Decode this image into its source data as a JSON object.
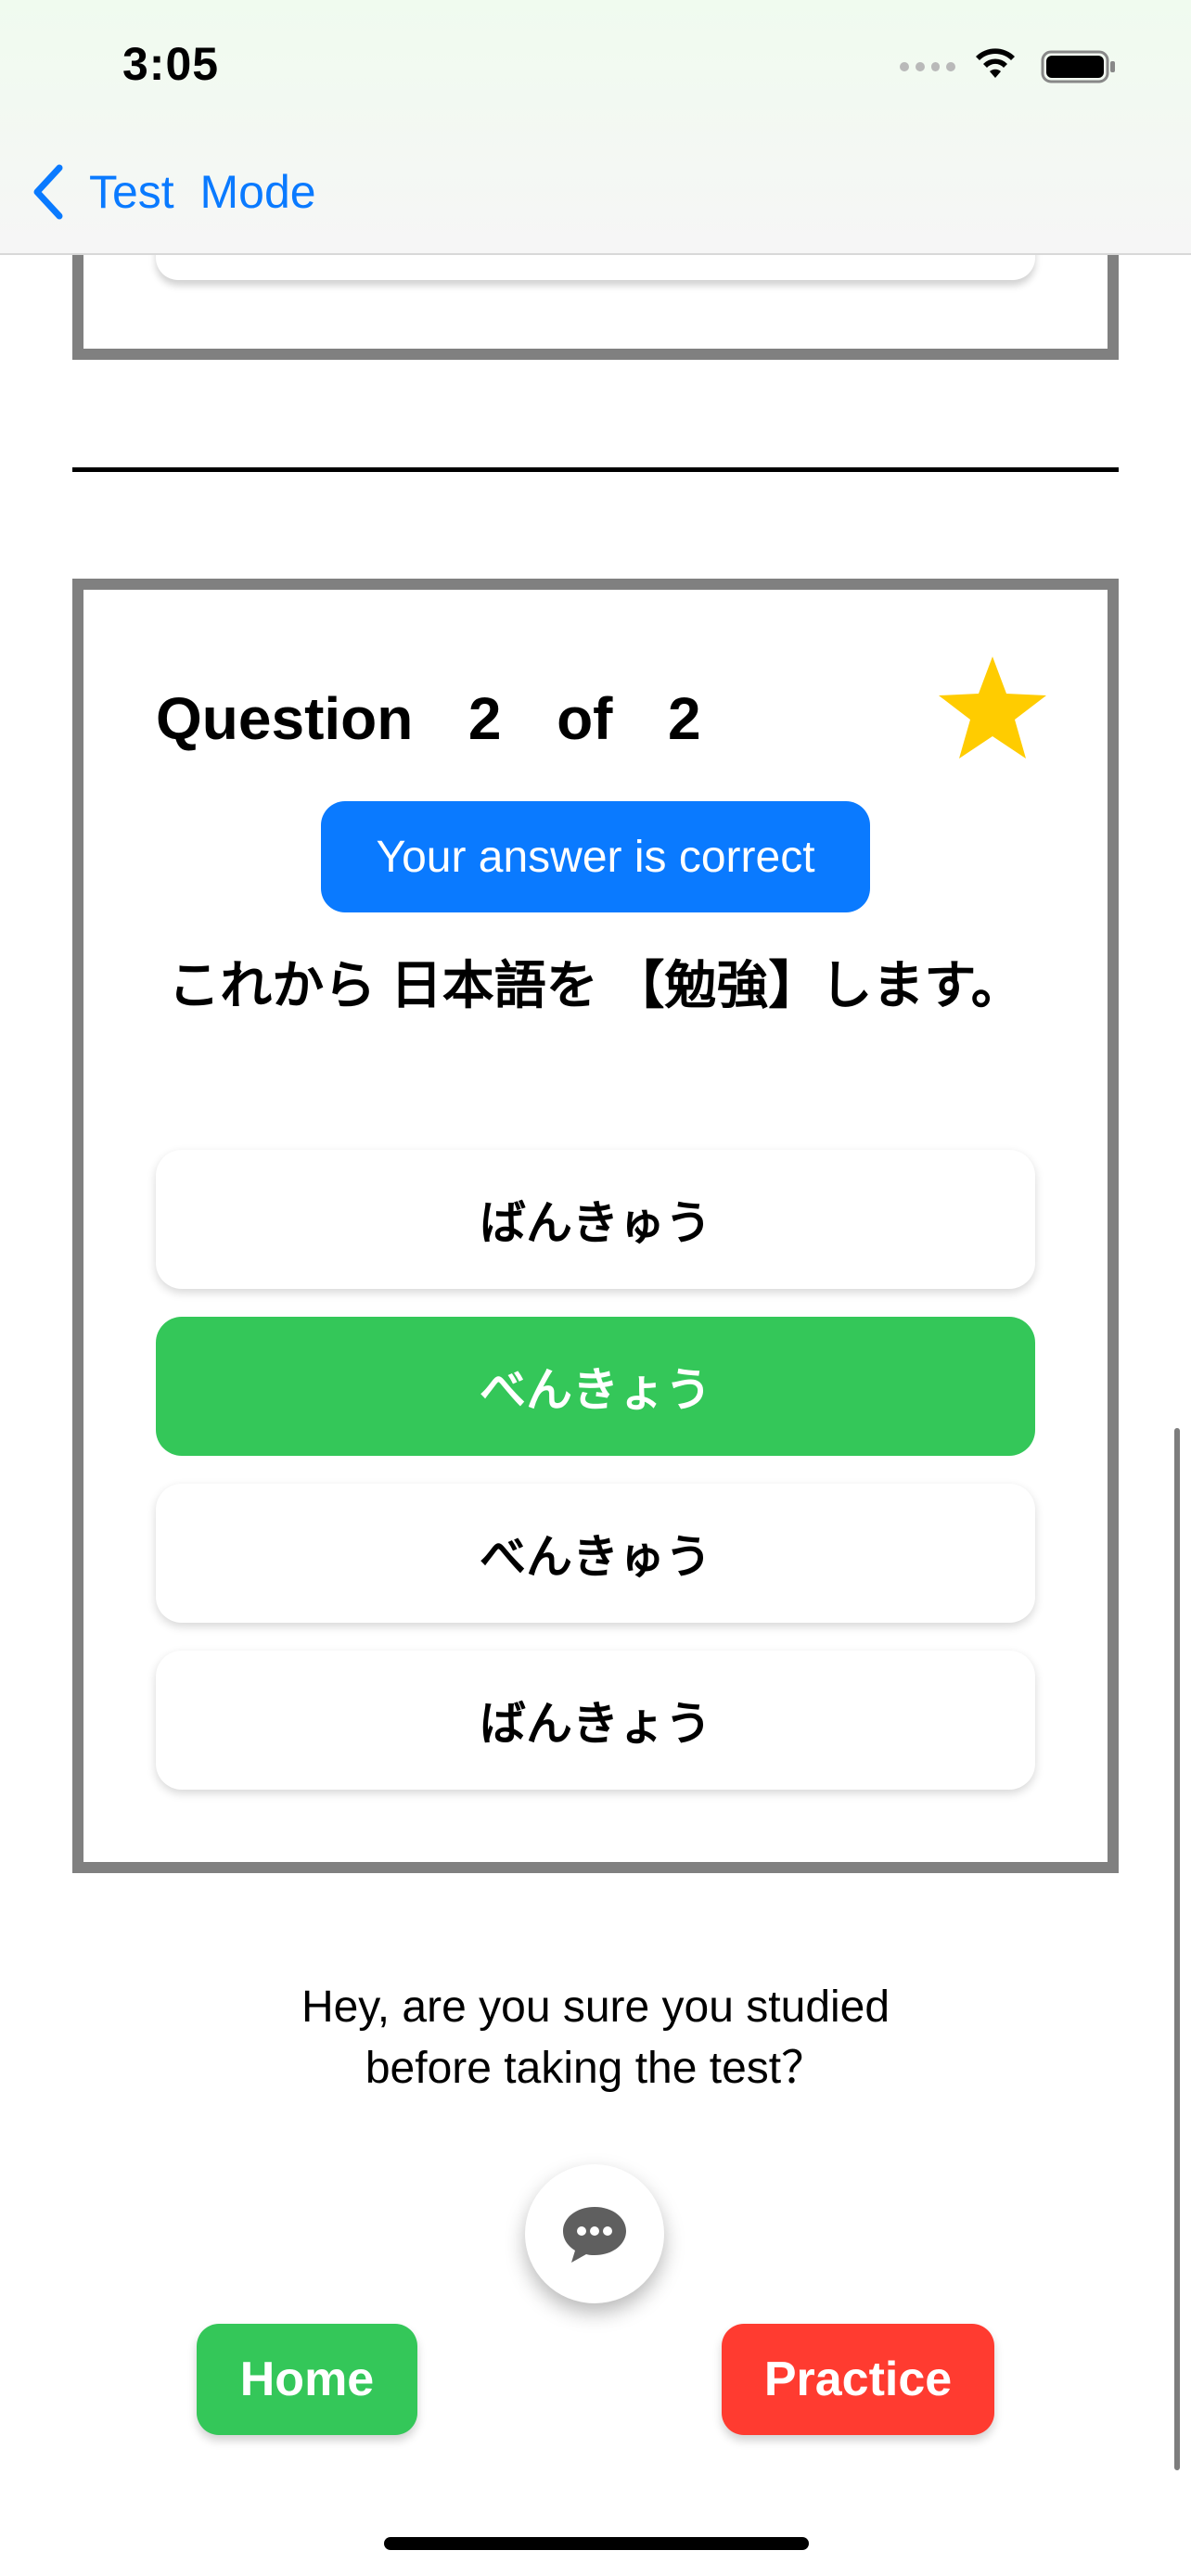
{
  "status_bar": {
    "time": "3:05"
  },
  "nav": {
    "back_label": "Test  Mode"
  },
  "question": {
    "title": "Question  2  of  2",
    "feedback": "Your answer is correct",
    "sentence": "これから 日本語を 【勉強】します。",
    "options": [
      {
        "label": "ばんきゅう"
      },
      {
        "label": "べんきょう",
        "state": "correct"
      },
      {
        "label": "べんきゅう"
      },
      {
        "label": "ばんきょう"
      }
    ]
  },
  "hint": {
    "line1": "Hey, are you sure you studied",
    "line2": "before taking the test？"
  },
  "buttons": {
    "home": "Home",
    "practice": "Practice"
  },
  "colors": {
    "accent_blue": "#0a7aff",
    "correct_green": "#34c759",
    "practice_red": "#ff3b30",
    "star_yellow": "#ffcc00",
    "card_border": "#808080"
  }
}
